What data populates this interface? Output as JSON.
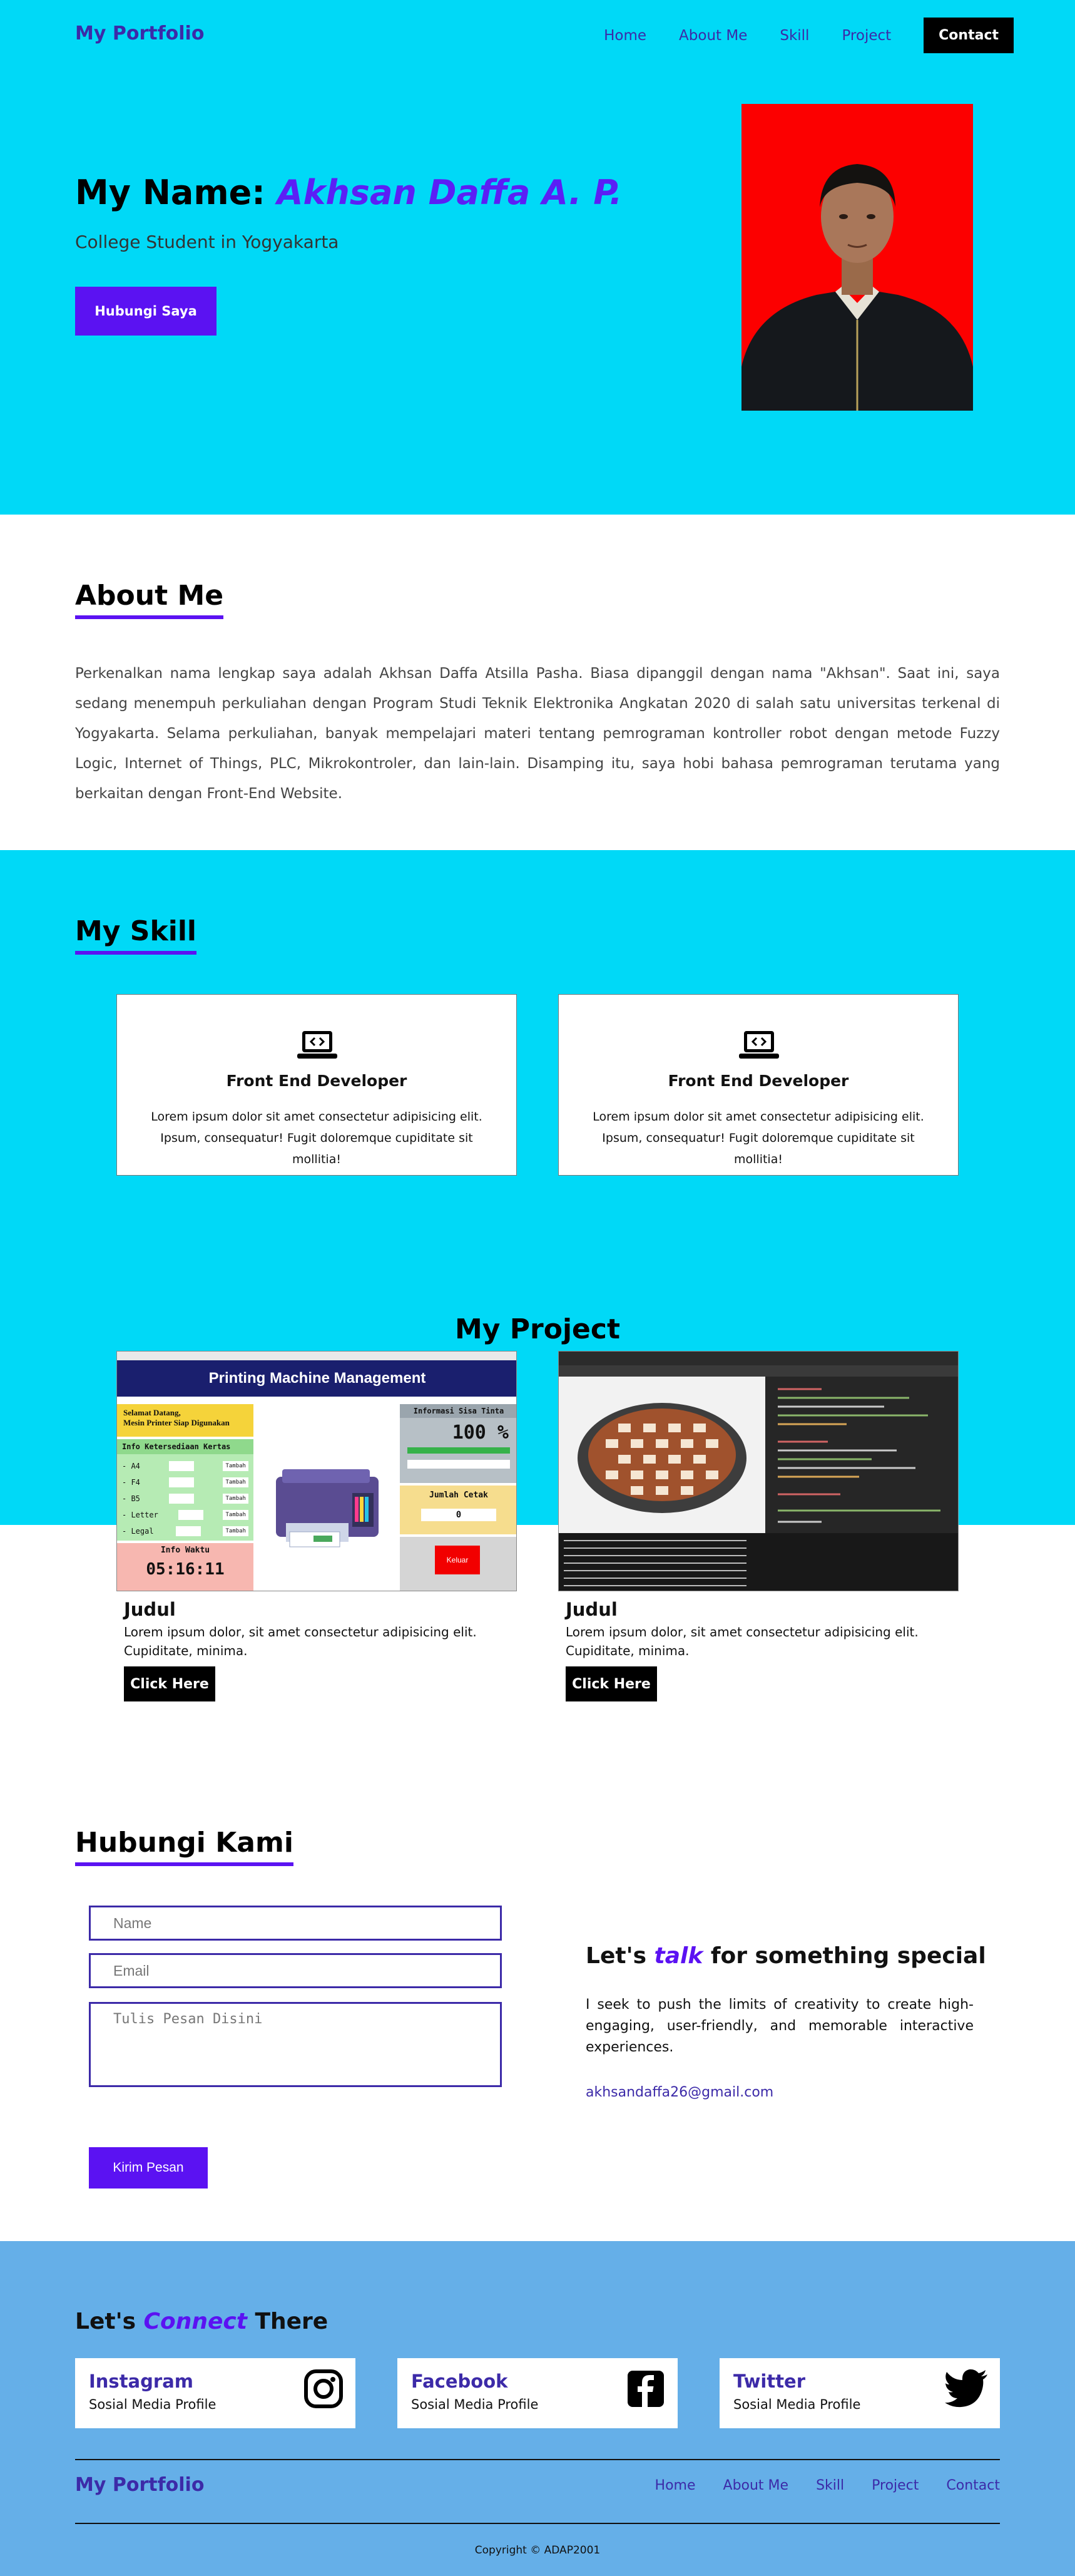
{
  "nav": {
    "brand": "My Portfolio",
    "links": [
      "Home",
      "About Me",
      "Skill",
      "Project"
    ],
    "contact": "Contact"
  },
  "hero": {
    "title_prefix": "My Name: ",
    "name": "Akhsan Daffa A. P.",
    "subtitle": "College Student in Yogyakarta",
    "button": "Hubungi Saya"
  },
  "about": {
    "heading": "About Me",
    "text": "Perkenalkan nama lengkap saya adalah Akhsan Daffa Atsilla Pasha. Biasa dipanggil dengan nama \"Akhsan\". Saat ini, saya sedang menempuh perkuliahan dengan Program Studi Teknik Elektronika Angkatan 2020 di salah satu universitas terkenal di Yogyakarta. Selama perkuliahan, banyak mempelajari materi tentang pemrograman kontroller robot dengan metode Fuzzy Logic, Internet of Things, PLC, Mikrokontroler, dan lain-lain. Disamping itu, saya hobi bahasa pemrograman terutama yang berkaitan dengan Front-End Website."
  },
  "skill": {
    "heading": "My Skill",
    "cards": [
      {
        "icon": "laptop-code-icon",
        "title": "Front End Developer",
        "desc": "Lorem ipsum dolor sit amet consectetur adipisicing elit. Ipsum, consequatur! Fugit doloremque cupiditate sit mollitia!"
      },
      {
        "icon": "laptop-code-icon",
        "title": "Front End Developer",
        "desc": "Lorem ipsum dolor sit amet consectetur adipisicing elit. Ipsum, consequatur! Fugit doloremque cupiditate sit mollitia!"
      }
    ]
  },
  "project": {
    "heading": "My Project",
    "cards": [
      {
        "title": "Judul",
        "desc": "Lorem ipsum dolor, sit amet consectetur adipisicing elit. Cupiditate, minima.",
        "button": "Click Here",
        "screen": {
          "header": "Printing Machine Management",
          "welcome_1": "Selamat Datang,",
          "welcome_2": "Mesin Printer Siap Digunakan",
          "stock_title": "Info Ketersediaan Kertas",
          "sizes": [
            "- A4",
            "- F4",
            "- B5",
            "- Letter",
            "- Legal"
          ],
          "add_label": "Tambah",
          "ink_title": "Informasi Sisa Tinta",
          "ink_value": "100 %",
          "count_title": "Jumlah Cetak",
          "count_value": "0",
          "time_title": "Info Waktu",
          "time_value": "05:16:11",
          "exit_label": "Keluar"
        }
      },
      {
        "title": "Judul",
        "desc": "Lorem ipsum dolor, sit amet consectetur adipisicing elit. Cupiditate, minima.",
        "button": "Click Here"
      }
    ]
  },
  "contact": {
    "heading": "Hubungi Kami",
    "name_placeholder": "Name",
    "email_placeholder": "Email",
    "message_placeholder": "Tulis Pesan Disini",
    "send": "Kirim Pesan",
    "cta_prefix": "Let's ",
    "cta_em": "talk",
    "cta_suffix": " for something special",
    "cta_text": "I seek to push the limits of creativity to create high-engaging, user-friendly, and memorable interactive experiences.",
    "email": "akhsandaffa26@gmail.com"
  },
  "footer": {
    "title_prefix": "Let's ",
    "title_em": "Connect",
    "title_suffix": " There",
    "socials": [
      {
        "name": "Instagram",
        "sub": "Sosial Media Profile",
        "icon": "instagram-icon"
      },
      {
        "name": "Facebook",
        "sub": "Sosial Media Profile",
        "icon": "facebook-icon"
      },
      {
        "name": "Twitter",
        "sub": "Sosial Media Profile",
        "icon": "twitter-icon"
      }
    ],
    "brand": "My Portfolio",
    "links": [
      "Home",
      "About Me",
      "Skill",
      "Project",
      "Contact"
    ],
    "copyright": "Copyright © ADAP2001"
  },
  "colors": {
    "cyan": "#00d9f7",
    "accent": "#5b12f2",
    "brand": "#3c2aa8",
    "footer_bg": "#65afe8",
    "photo_bg": "#fc0000"
  }
}
